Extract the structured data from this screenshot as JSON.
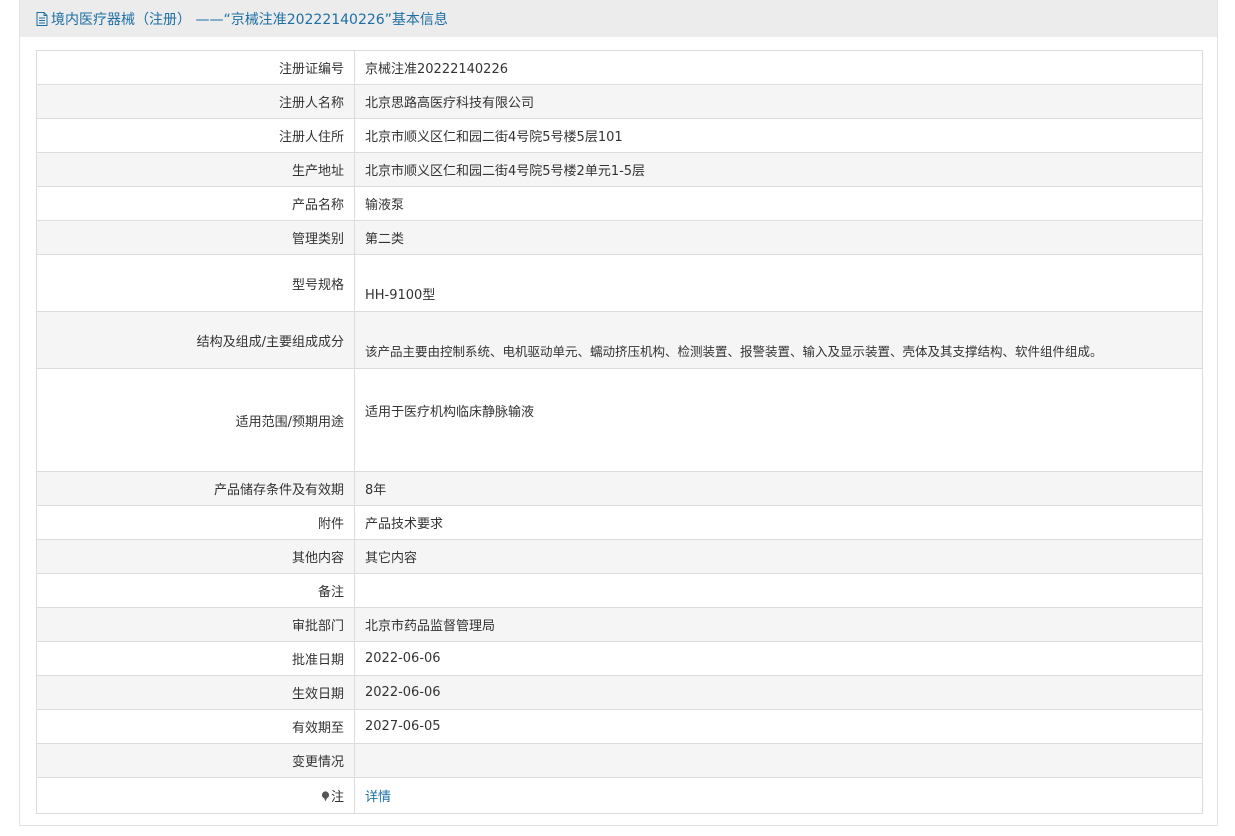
{
  "header": {
    "title": "境内医疗器械（注册） ——“京械注准20222140226”基本信息"
  },
  "rows": [
    {
      "label": "注册证编号",
      "value": "京械注准20222140226"
    },
    {
      "label": "注册人名称",
      "value": "北京思路高医疗科技有限公司"
    },
    {
      "label": "注册人住所",
      "value": "北京市顺义区仁和园二街4号院5号楼5层101"
    },
    {
      "label": "生产地址",
      "value": "北京市顺义区仁和园二街4号院5号楼2单元1-5层"
    },
    {
      "label": "产品名称",
      "value": "输液泵"
    },
    {
      "label": "管理类别",
      "value": "第二类"
    },
    {
      "label": "型号规格",
      "value": "HH-9100型"
    },
    {
      "label": "结构及组成/主要组成成分",
      "value": "该产品主要由控制系统、电机驱动单元、蠕动挤压机构、检测装置、报警装置、输入及显示装置、壳体及其支撑结构、软件组件组成。"
    },
    {
      "label": "适用范围/预期用途",
      "value": "适用于医疗机构临床静脉输液"
    },
    {
      "label": "产品储存条件及有效期",
      "value": "8年"
    },
    {
      "label": "附件",
      "value": "产品技术要求"
    },
    {
      "label": "其他内容",
      "value": "其它内容"
    },
    {
      "label": "备注",
      "value": ""
    },
    {
      "label": "审批部门",
      "value": "北京市药品监督管理局"
    },
    {
      "label": "批准日期",
      "value": "2022-06-06"
    },
    {
      "label": "生效日期",
      "value": "2022-06-06"
    },
    {
      "label": "有效期至",
      "value": "2027-06-05"
    },
    {
      "label": "变更情况",
      "value": ""
    },
    {
      "label": "注",
      "value": "详情"
    }
  ],
  "colors": {
    "header_bg": "#ececec",
    "header_text": "#1d6fa5",
    "link": "#1d6fa5",
    "row_alt_bg": "#f5f5f5",
    "border": "#dcdcdc"
  },
  "icons": {
    "header_icon": "document-icon",
    "note_icon": "pin-icon"
  }
}
